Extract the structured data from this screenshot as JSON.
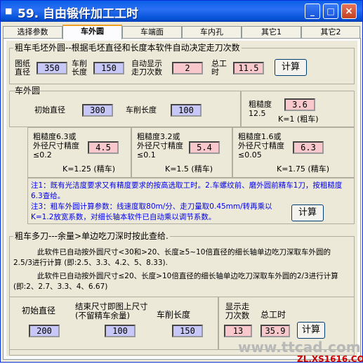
{
  "window": {
    "title": "59. 自由锻件加工工时",
    "icon": "app-icon",
    "controls": {
      "minimize": "_",
      "maximize": "□",
      "close": "×"
    }
  },
  "tabs": [
    "选择参数",
    "车外圆",
    "车端面",
    "车内孔",
    "其它1",
    "其它2"
  ],
  "active_tab": "车外圆",
  "rough_group": {
    "title": "粗车毛坯外圆--根据毛坯直径和长度本软件自动决定走刀次数",
    "blank_dia_label": "图纸直径",
    "blank_dia": "350",
    "length_label": "车削长度",
    "length": "150",
    "passes_label": "自动显示走刀次数",
    "passes": "2",
    "total_label": "总工时",
    "total": "11.5",
    "calc": "计算"
  },
  "outer_group": {
    "title": "车外圆",
    "init_dia_label": "初始直径",
    "init_dia": "300",
    "length_label": "车削长度",
    "length": "100",
    "rough_label": "粗糙度",
    "rough_value": "3.6",
    "rough_default": "12.5",
    "rough_k": "K=1 (粗车)",
    "col1_label": "粗糙度6.3或外径尺寸精度≤0.2",
    "col1_value": "4.5",
    "col1_k": "K=1.25 (精车)",
    "col2_label": "粗糙度3.2或外径尺寸精度≤0.1",
    "col2_value": "5.4",
    "col2_k": "K=1.5 (精车)",
    "col3_label": "粗糙度1.6或外径尺寸精度≤0.05",
    "col3_value": "6.3",
    "col3_k": "K=1.75 (精车)",
    "note1": "注1：既有光洁度要求又有精度要求的按高选取工时。2.车螺纹前、磨外圆前精车1刀，按粗糙度6.3查给。",
    "note3": "注3：粗车外圆计算参数：线速度取80m/分、走刀量取0.45mm/转再乘以K=1.2放宽系数，对细长轴本软件已自动乘以调节系数。",
    "calc": "计算"
  },
  "multi_group": {
    "title": "粗车多刀---余量>单边吃刀深时按此查给.",
    "text1": "此软件已自动按外圆尺寸<30和>20、长度≥5~10倍直径的细长轴单边吃刀深取车外圆的2.5/3进行计算 (即:2.5、3.3、4.2、5、8.33).",
    "text2": "此软件已自动按外圆尺寸≤20、长度>10倍直径的细长轴单边吃刀深取车外圆的2/3进行计算 (即:2、2.7、3.3、4、6.67)",
    "init_dia_label": "初始直径",
    "init_dia": "200",
    "end_label": "结束尺寸即图上尺寸(不留精车余量)",
    "end_value": "100",
    "length_label": "车削长度",
    "length": "150",
    "passes_label": "显示走刀次数",
    "passes": "13",
    "total_label": "总工时",
    "total": "35.9",
    "calc": "计算"
  },
  "watermark": {
    "line1": "www.ttcad.com",
    "line2": "ZL.XS1616.COM"
  }
}
